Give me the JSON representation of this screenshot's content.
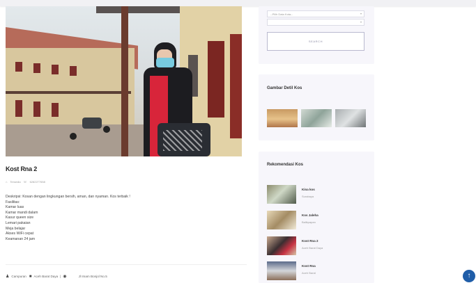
{
  "listing": {
    "title": "Kost Rna 2",
    "meta_type": "Tersedia",
    "meta_phone": "6282277658",
    "description_lines": [
      "Deskripsi: Kosan dengan lingkungan bersih, aman, dan nyaman. Kos terbaik !",
      "Fasilitas:",
      "Kamar luas",
      "Kamar mandi dalam",
      "Kasur queen size",
      "Lemari pakaian",
      "Meja belajar",
      "Akses WiFi cepat",
      "Keamanan 24 jam"
    ],
    "footer_gender": "Campuran",
    "footer_area": "Aceh Barat Daya",
    "footer_address": "Jl Imam Bonjol No.5"
  },
  "filter": {
    "city_select": "--Pilih Data Kota--",
    "second_select": "",
    "search_label": "SEARCH"
  },
  "gallery": {
    "title": "Gambar Detil Kos"
  },
  "recommend": {
    "title": "Rekomendasi Kos",
    "items": [
      {
        "name": "Kina kos",
        "location": "Surabaya"
      },
      {
        "name": "Kos Jaleha",
        "location": "Balikpapan"
      },
      {
        "name": "Kost Rna 2",
        "location": "Aceh Barat Daya"
      },
      {
        "name": "Kost Rna",
        "location": "Aceh Barat"
      }
    ]
  },
  "colors": {
    "accent": "#1f5da8",
    "panel_bg": "#f7f6fb"
  }
}
